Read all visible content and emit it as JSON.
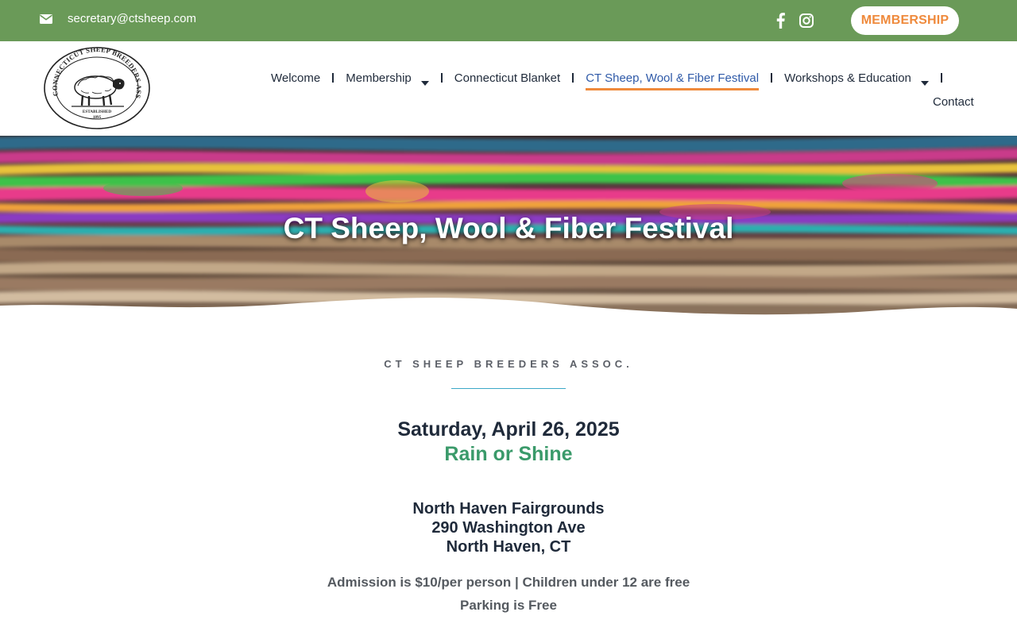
{
  "topbar": {
    "email": "secretary@ctsheep.com",
    "email_icon": "envelope-icon",
    "social": [
      "facebook-icon",
      "instagram-icon"
    ],
    "membership_button": "MEMBERSHIP"
  },
  "logo": {
    "ring_text": "CONNECTICUT SHEEP BREEDERS ASSOCIATION, INC.",
    "established": "ESTABLISHED",
    "year": "1895"
  },
  "nav": {
    "items": [
      {
        "label": "Welcome",
        "dropdown": false,
        "active": false
      },
      {
        "label": "Membership",
        "dropdown": true,
        "active": false
      },
      {
        "label": "Connecticut Blanket",
        "dropdown": false,
        "active": false
      },
      {
        "label": "CT Sheep, Wool & Fiber Festival",
        "dropdown": false,
        "active": true
      },
      {
        "label": "Workshops & Education",
        "dropdown": true,
        "active": false
      }
    ],
    "contact": "Contact"
  },
  "hero": {
    "title": "CT Sheep, Wool & Fiber Festival"
  },
  "content": {
    "eyebrow": "CT SHEEP BREEDERS ASSOC.",
    "date": "Saturday, April 26, 2025",
    "weather": "Rain or Shine",
    "venue_line1": "North Haven Fairgrounds",
    "venue_line2": "290 Washington Ave",
    "venue_line3": "North Haven, CT",
    "admission": "Admission is $10/per person | Children under 12 are free",
    "parking": "Parking is Free"
  },
  "colors": {
    "topbar": "#6a9a58",
    "accent_orange": "#ef8a3c",
    "green_text": "#3a9a6a",
    "divider": "#3ba8c8",
    "active_nav": "#2f5aa8"
  }
}
